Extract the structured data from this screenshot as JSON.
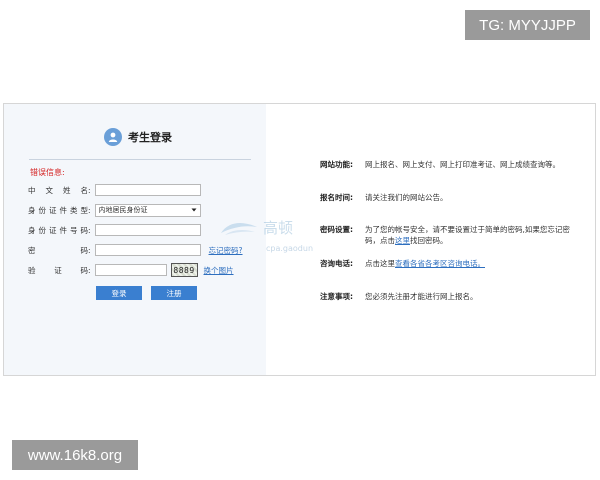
{
  "watermarks": {
    "top": "TG: MYYJJPP",
    "bottom": "www.16k8.org"
  },
  "login": {
    "title": "考生登录",
    "error_label": "错误信息:",
    "fields": {
      "name_label": "中文姓名",
      "id_type_label": "身份证件类型",
      "id_type_value": "内地居民身份证",
      "id_number_label": "身份证件号码",
      "password_label": "密码",
      "captcha_label": "验证码"
    },
    "colon": ":",
    "forgot_password": "忘记密码?",
    "captcha_image_text": "8889",
    "change_captcha": "换个图片",
    "login_button": "登录",
    "register_button": "注册"
  },
  "faint_logo": {
    "text": "高顿",
    "url": "cpa.gaodun"
  },
  "info": {
    "items": [
      {
        "label": "网站功能:",
        "text": "网上报名、网上支付、网上打印准考证、网上成绩查询等。"
      },
      {
        "label": "报名时间:",
        "text": "请关注我们的网站公告。"
      },
      {
        "label": "密码设置:",
        "text_before": "为了您的帐号安全，请不要设置过于简单的密码,如果您忘记密码，点击",
        "link": "这里",
        "text_after": "找回密码。"
      },
      {
        "label": "咨询电话:",
        "text_before": "点击这里",
        "link": "查看各省各考区咨询电话。",
        "text_after": ""
      },
      {
        "label": "注意事项:",
        "text": "您必须先注册才能进行网上报名。"
      }
    ]
  },
  "colors": {
    "accent": "#3a7fd0",
    "link": "#2e6fbf",
    "error": "#d42020",
    "panel_bg": "#f4f7fb"
  },
  "icons": [
    "user-icon",
    "chevron-down-icon",
    "logo-icon"
  ]
}
